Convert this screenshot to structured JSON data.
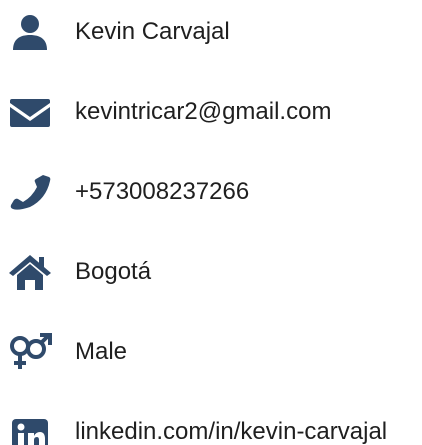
{
  "colors": {
    "icon": "#2f4a6b",
    "text": "#1f1f1f"
  },
  "contact": {
    "name": {
      "icon": "user-icon",
      "text": "Kevin Carvajal"
    },
    "email": {
      "icon": "envelope-icon",
      "text": "kevintricar2@gmail.com"
    },
    "phone": {
      "icon": "phone-icon",
      "text": "+573008237266"
    },
    "city": {
      "icon": "home-icon",
      "text": "Bogotá"
    },
    "gender": {
      "icon": "gender-icon",
      "text": "Male"
    },
    "linkedin": {
      "icon": "linkedin-icon",
      "text": "linkedin.com/in/kevin-carvajal"
    }
  }
}
